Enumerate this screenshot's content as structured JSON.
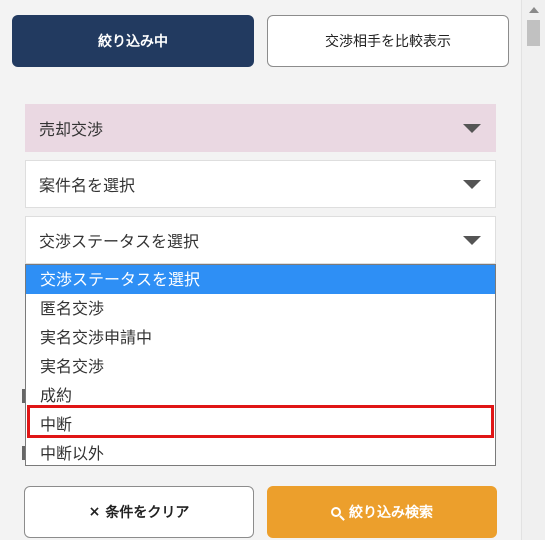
{
  "top_buttons": {
    "filtering_label": "絞り込み中",
    "compare_label": "交渉相手を比較表示"
  },
  "filters": {
    "sale_type": "売却交渉",
    "case_name_placeholder": "案件名を選択",
    "status_placeholder": "交渉ステータスを選択"
  },
  "status_dropdown": {
    "options": [
      "交渉ステータスを選択",
      "匿名交渉",
      "実名交渉申請中",
      "実名交渉",
      "成約",
      "中断",
      "中断以外"
    ],
    "selected_index": 0,
    "highlighted_option": "中断"
  },
  "bottom_buttons": {
    "clear_icon": "×",
    "clear_label": "条件をクリア",
    "search_label": "絞り込み検索"
  },
  "colors": {
    "primary_navy": "#223a60",
    "accent_orange": "#ec9f2c",
    "selected_blue": "#2e8ff5",
    "highlight_red": "#e01515",
    "pink_field": "#ead8e2"
  }
}
